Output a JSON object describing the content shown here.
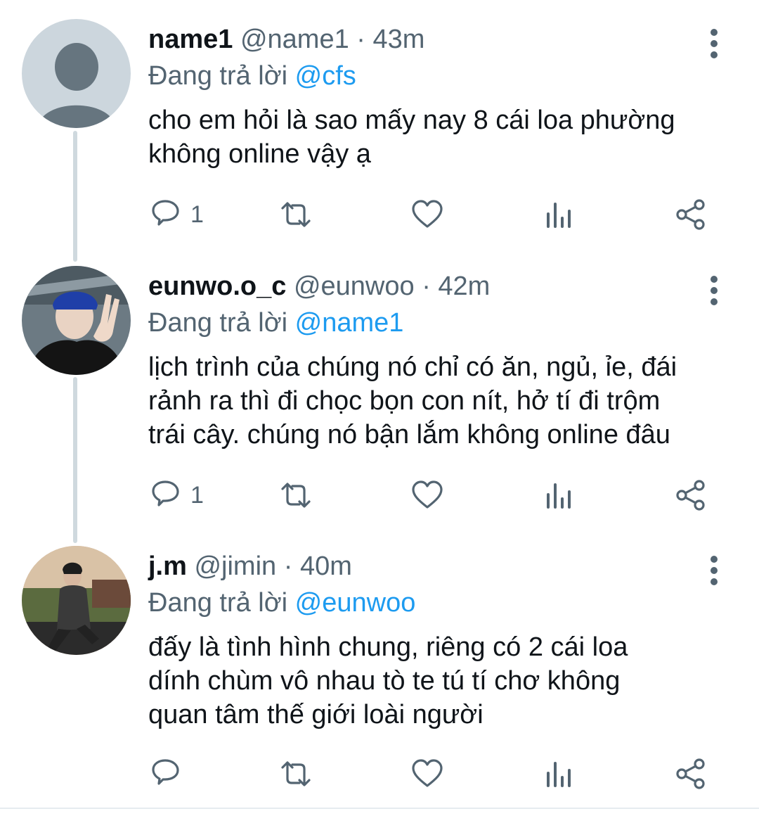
{
  "tweets": [
    {
      "name": "name1",
      "handle": "@name1",
      "dot": "·",
      "time": "43m",
      "reply_prefix": "Đang trả lời",
      "reply_to": "@cfs",
      "lines": [
        "cho em hỏi là sao mấy nay 8 cái loa phường",
        "không online vậy ạ"
      ],
      "reply_count": "1",
      "avatar": "default-avatar"
    },
    {
      "name": "eunwo.o_c",
      "handle": "@eunwoo",
      "dot": "·",
      "time": "42m",
      "reply_prefix": "Đang trả lời",
      "reply_to": "@name1",
      "lines": [
        "lịch trình của chúng nó chỉ có ăn, ngủ, ỉe, đái",
        "rảnh ra thì đi chọc bọn con nít, hở tí đi trộm",
        "trái cây. chúng nó bận lắm không online đâu"
      ],
      "reply_count": "1",
      "avatar": "photo-avatar"
    },
    {
      "name": "j.m",
      "handle": "@jimin",
      "dot": "·",
      "time": "40m",
      "reply_prefix": "Đang trả lời",
      "reply_to": "@eunwoo",
      "lines": [
        "đấy là tình hình chung, riêng có 2 cái loa",
        "dính chùm vô nhau tò te tú tí chơ không",
        "quan tâm thế giới loài người"
      ],
      "reply_count": "",
      "avatar": "photo-avatar"
    }
  ],
  "colors": {
    "accent": "#1d9bf0",
    "secondary_text": "#536471",
    "primary_text": "#0f1419",
    "thread_line": "#cfd9de"
  },
  "icons": [
    "reply-icon",
    "retweet-icon",
    "like-icon",
    "analytics-icon",
    "share-icon",
    "more-icon"
  ]
}
